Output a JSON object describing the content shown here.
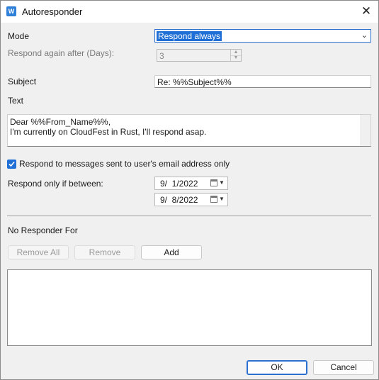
{
  "window": {
    "title": "Autoresponder",
    "app_icon_text": "W",
    "close_glyph": "✕"
  },
  "mode": {
    "label": "Mode",
    "value": "Respond always"
  },
  "respond_again": {
    "label": "Respond again after (Days):",
    "value": "3"
  },
  "subject": {
    "label": "Subject",
    "value": "Re: %%Subject%%"
  },
  "text": {
    "label": "Text",
    "lines": [
      "Dear %%From_Name%%,",
      "I'm currently on CloudFest in Rust, I'll respond asap."
    ]
  },
  "only_user_address": {
    "label": "Respond to messages sent to user's email address only",
    "checked": true
  },
  "date_range": {
    "label": "Respond only if between:",
    "from": "9/  1/2022",
    "to": "9/  8/2022"
  },
  "no_responder": {
    "label": "No Responder For",
    "remove_all_label": "Remove All",
    "remove_label": "Remove",
    "add_label": "Add"
  },
  "footer": {
    "ok_label": "OK",
    "cancel_label": "Cancel"
  },
  "colors": {
    "accent": "#1f6fd6",
    "background": "#f0f0f0"
  }
}
